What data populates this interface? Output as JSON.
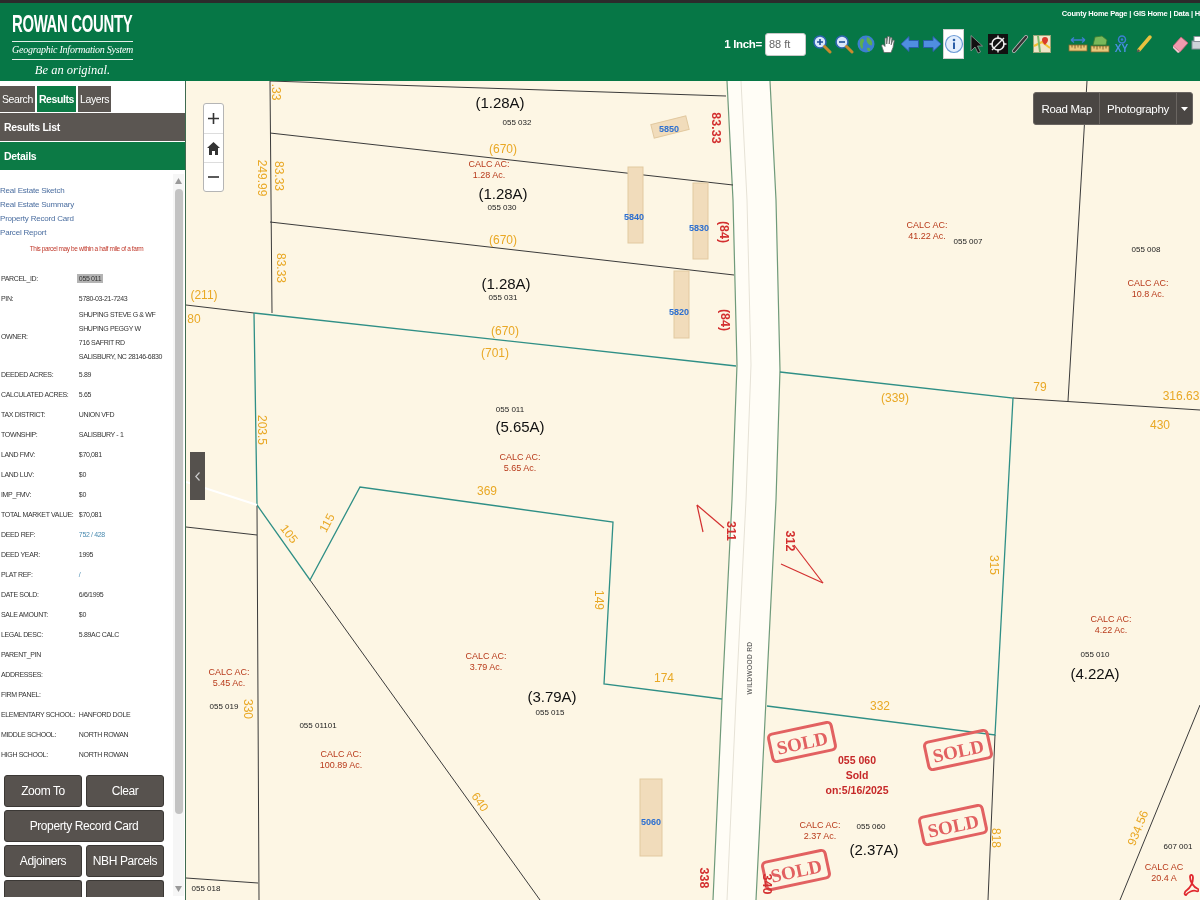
{
  "header": {
    "logo": {
      "title": "ROWAN COUNTY",
      "subtitle": "Geographic Information System",
      "tagline": "Be an original."
    },
    "links": [
      "County Home Page",
      "GIS Home",
      "Data",
      "H"
    ],
    "link_separator": "|",
    "scale": {
      "label": "1 Inch=",
      "value": "88 ft"
    },
    "tools": [
      {
        "kind": "zoom_in",
        "selected": false
      },
      {
        "kind": "zoom_out",
        "selected": false
      },
      {
        "kind": "globe",
        "selected": false
      },
      {
        "kind": "pan",
        "selected": false
      },
      {
        "kind": "back",
        "selected": false
      },
      {
        "kind": "forward",
        "selected": false
      },
      {
        "kind": "identify",
        "selected": true
      },
      {
        "kind": "select",
        "selected": false
      },
      {
        "kind": "crosshair",
        "selected": false
      },
      {
        "kind": "line",
        "selected": false
      },
      {
        "kind": "map",
        "selected": false
      },
      {
        "kind": "measure_distance",
        "selected": false
      },
      {
        "kind": "measure_area",
        "selected": false
      },
      {
        "kind": "coordinates",
        "label": "XY",
        "selected": false
      },
      {
        "kind": "pencil",
        "selected": false
      },
      {
        "kind": "eraser",
        "selected": false
      },
      {
        "kind": "print",
        "selected": false
      }
    ]
  },
  "sidebar": {
    "tabs": [
      {
        "label": "Search",
        "selected": false
      },
      {
        "label": "Results",
        "selected": true
      },
      {
        "label": "Layers",
        "selected": false
      }
    ],
    "sections": [
      {
        "label": "Results List",
        "expanded": false
      },
      {
        "label": "Details",
        "expanded": true
      }
    ],
    "details": {
      "links": [
        "Real Estate Sketch",
        "Real Estate Summary",
        "Property Record Card",
        "Parcel Report"
      ],
      "notice": "This parcel may be within a half mile of a farm",
      "fields": [
        {
          "label": "PARCEL_ID:",
          "value": "055 011",
          "kind": "text",
          "highlighted": true
        },
        {
          "label": "PIN:",
          "value": "5780-03-21-7243",
          "kind": "text",
          "highlighted": false
        },
        {
          "label": "OWNER:",
          "lines": [
            "SHUPING STEVE G & WF",
            "SHUPING PEGGY W",
            "716 SAFRIT RD",
            "SALISBURY, NC 28146-6830"
          ],
          "kind": "text",
          "highlighted": false
        },
        {
          "label": "DEEDED ACRES:",
          "value": "5.89",
          "kind": "text",
          "highlighted": false
        },
        {
          "label": "CALCULATED ACRES:",
          "value": "5.65",
          "kind": "text",
          "highlighted": false
        },
        {
          "label": "TAX DISTRICT:",
          "value": "UNION VFD",
          "kind": "text",
          "highlighted": false
        },
        {
          "label": "TOWNSHIP:",
          "value": "SALISBURY - 1",
          "kind": "text",
          "highlighted": false
        },
        {
          "label": "LAND FMV:",
          "value": "$70,081",
          "kind": "text",
          "highlighted": false
        },
        {
          "label": "LAND LUV:",
          "value": "$0",
          "kind": "text",
          "highlighted": false
        },
        {
          "label": "IMP_FMV:",
          "value": "$0",
          "kind": "text",
          "highlighted": false
        },
        {
          "label": "TOTAL MARKET VALUE:",
          "value": "$70,081",
          "kind": "text",
          "highlighted": false
        },
        {
          "label": "DEED REF:",
          "value": "752 / 428",
          "kind": "link",
          "highlighted": false
        },
        {
          "label": "DEED YEAR:",
          "value": "1995",
          "kind": "text",
          "highlighted": false
        },
        {
          "label": "PLAT REF:",
          "value": "/",
          "kind": "link",
          "highlighted": false
        },
        {
          "label": "DATE SOLD:",
          "value": "6/6/1995",
          "kind": "text",
          "highlighted": false
        },
        {
          "label": "SALE AMOUNT:",
          "value": "$0",
          "kind": "text",
          "highlighted": false
        },
        {
          "label": "LEGAL DESC:",
          "value": "5.89AC CALC",
          "kind": "text",
          "highlighted": false
        },
        {
          "label": "PARENT_PIN",
          "kind": "text",
          "highlighted": false
        },
        {
          "label": "ADDRESSES:",
          "kind": "text",
          "highlighted": false
        },
        {
          "label": "FIRM PANEL:",
          "kind": "text",
          "highlighted": false
        },
        {
          "label": "ELEMENTARY SCHOOL:",
          "value": "HANFORD DOLE",
          "kind": "text",
          "highlighted": false
        },
        {
          "label": "MIDDLE SCHOOL:",
          "value": "NORTH ROWAN",
          "kind": "text",
          "highlighted": false
        },
        {
          "label": "HIGH SCHOOL:",
          "value": "NORTH ROWAN",
          "kind": "text",
          "highlighted": false
        }
      ]
    },
    "button_rows": [
      {
        "buttons": [
          {
            "kind": "full",
            "label": "Zoom To"
          },
          {
            "kind": "full",
            "label": "Clear"
          }
        ]
      },
      {
        "buttons": [
          {
            "kind": "full",
            "label": "Property Record Card"
          }
        ]
      },
      {
        "buttons": [
          {
            "kind": "full",
            "label": "Adjoiners"
          },
          {
            "kind": "full",
            "label": "NBH Parcels"
          }
        ]
      },
      {
        "buttons": [
          {
            "kind": "cut_off"
          },
          {
            "kind": "cut_off"
          }
        ]
      }
    ]
  },
  "map": {
    "basemaps": [
      "Road Map",
      "Photography"
    ],
    "labels": [
      {
        "kind": "acreage",
        "text": "(1.28A)"
      },
      {
        "kind": "parcel_id",
        "text": "055 032"
      },
      {
        "kind": "dimension",
        "text": "(670)"
      },
      {
        "kind": "calc",
        "lines": [
          "CALC AC:",
          "1.28 Ac."
        ]
      },
      {
        "kind": "acreage",
        "text": "(1.28A)"
      },
      {
        "kind": "parcel_id",
        "text": "055 030"
      },
      {
        "kind": "dimension",
        "text": "(670)"
      },
      {
        "kind": "acreage",
        "text": "(1.28A)"
      },
      {
        "kind": "parcel_id",
        "text": "055 031"
      },
      {
        "kind": "dimension",
        "text": "(670)"
      },
      {
        "kind": "dimension",
        "text": "(701)"
      },
      {
        "kind": "dimension",
        "text": "(211)"
      },
      {
        "kind": "dimension",
        "text": "80"
      },
      {
        "kind": "dimension",
        "text": ".33"
      },
      {
        "kind": "dimension",
        "text": "249.99"
      },
      {
        "kind": "dimension",
        "text": "83.33"
      },
      {
        "kind": "dimension",
        "text": "83.33"
      },
      {
        "kind": "boundary",
        "text": "83.33"
      },
      {
        "kind": "boundary",
        "text": "(84)"
      },
      {
        "kind": "boundary",
        "text": "(84)"
      },
      {
        "kind": "dimension",
        "text": "203.5"
      },
      {
        "kind": "parcel_id",
        "text": "055 011"
      },
      {
        "kind": "acreage",
        "text": "(5.65A)"
      },
      {
        "kind": "calc",
        "lines": [
          "CALC AC:",
          "5.65 Ac."
        ]
      },
      {
        "kind": "dimension",
        "text": "369"
      },
      {
        "kind": "dimension",
        "text": "105"
      },
      {
        "kind": "dimension",
        "text": "115"
      },
      {
        "kind": "dimension",
        "text": "149"
      },
      {
        "kind": "dimension",
        "text": "174"
      },
      {
        "kind": "calc",
        "lines": [
          "CALC AC:",
          "3.79 Ac."
        ]
      },
      {
        "kind": "acreage",
        "text": "(3.79A)"
      },
      {
        "kind": "parcel_id",
        "text": "055 015"
      },
      {
        "kind": "calc",
        "lines": [
          "CALC AC:",
          "5.45 Ac."
        ]
      },
      {
        "kind": "parcel_id",
        "text": "055 019"
      },
      {
        "kind": "dimension",
        "text": "330"
      },
      {
        "kind": "parcel_id",
        "text": "055 01101"
      },
      {
        "kind": "calc",
        "lines": [
          "CALC AC:",
          "100.89 Ac."
        ]
      },
      {
        "kind": "dimension",
        "text": "640"
      },
      {
        "kind": "parcel_id",
        "text": "055 018"
      },
      {
        "kind": "boundary",
        "text": "338"
      },
      {
        "kind": "boundary",
        "text": "340"
      },
      {
        "kind": "boundary",
        "text": "311"
      },
      {
        "kind": "boundary",
        "text": "312"
      },
      {
        "kind": "road",
        "text": "WILDWOOD RD"
      },
      {
        "kind": "dimension",
        "text": "(339)"
      },
      {
        "kind": "dimension",
        "text": "79"
      },
      {
        "kind": "dimension",
        "text": "316.63"
      },
      {
        "kind": "dimension",
        "text": "430"
      },
      {
        "kind": "calc",
        "lines": [
          "CALC AC:",
          "41.22 Ac."
        ]
      },
      {
        "kind": "parcel_id",
        "text": "055 007"
      },
      {
        "kind": "parcel_id",
        "text": "055 008"
      },
      {
        "kind": "calc",
        "lines": [
          "CALC AC:",
          "10.8 Ac."
        ]
      },
      {
        "kind": "dimension",
        "text": "315"
      },
      {
        "kind": "dimension",
        "text": "332"
      },
      {
        "kind": "calc",
        "lines": [
          "CALC AC:",
          "4.22 Ac."
        ]
      },
      {
        "kind": "parcel_id",
        "text": "055 010"
      },
      {
        "kind": "acreage",
        "text": "(4.22A)"
      },
      {
        "kind": "sale",
        "lines": [
          "055 060",
          "Sold",
          "on:5/16/2025"
        ]
      },
      {
        "kind": "calc",
        "lines": [
          "CALC AC:",
          "2.37 Ac."
        ]
      },
      {
        "kind": "parcel_id",
        "text": "055 060"
      },
      {
        "kind": "acreage",
        "text": "(2.37A)"
      },
      {
        "kind": "dimension",
        "text": "818"
      },
      {
        "kind": "dimension",
        "text": "934.56"
      },
      {
        "kind": "parcel_id",
        "text": "607 001"
      },
      {
        "kind": "calc",
        "lines": [
          "CALC AC",
          "20.4 A"
        ]
      },
      {
        "kind": "address",
        "text": "5850"
      },
      {
        "kind": "address",
        "text": "5840"
      },
      {
        "kind": "address",
        "text": "5830"
      },
      {
        "kind": "address",
        "text": "5820"
      },
      {
        "kind": "address",
        "text": "5060"
      }
    ],
    "sold_stamps": [
      "SOLD",
      "SOLD",
      "SOLD",
      "SOLD"
    ]
  }
}
